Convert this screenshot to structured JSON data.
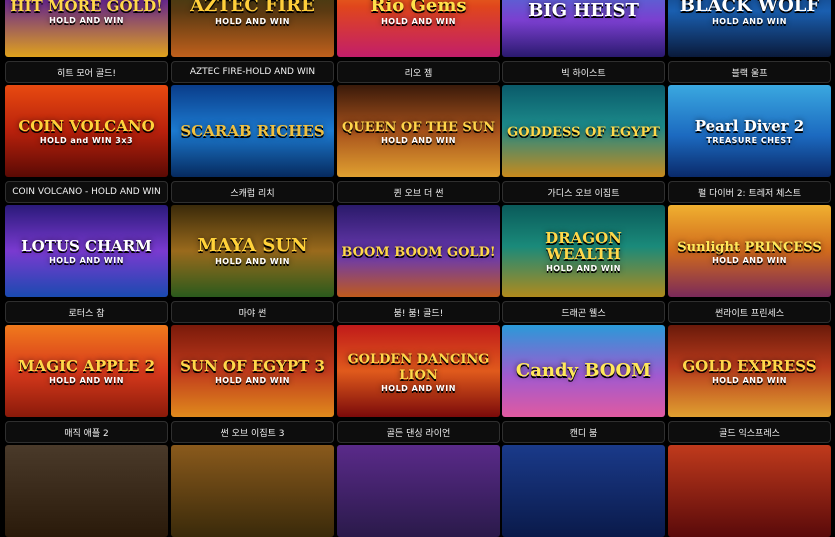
{
  "games": [
    {
      "title": "히트 모어 골드!",
      "art": "HIT MORE GOLD!",
      "sub": "HOLD AND WIN",
      "bg": "linear-gradient(180deg,#1a0a2e 0%,#6b2a8c 40%,#e0a21c 100%)",
      "fg": "#ffd84a"
    },
    {
      "title": "AZTEC FIRE-HOLD AND WIN",
      "art": "AZTEC FIRE",
      "sub": "HOLD AND WIN",
      "bg": "linear-gradient(180deg,#1f3d14 0%,#5b3a12 50%,#c0601c 100%)",
      "fg": "#ffcf3a"
    },
    {
      "title": "리오 젬",
      "art": "Rio Gems",
      "sub": "HOLD AND WIN",
      "bg": "linear-gradient(180deg,#f29a1c 0%,#e0461c 45%,#c21e6a 100%)",
      "fg": "#ffe14a"
    },
    {
      "title": "빅 하이스트",
      "art": "BIG HEIST",
      "sub": "",
      "bg": "linear-gradient(180deg,#2f8fd8 0%,#7b3fd0 60%,#2a1a6e 100%)",
      "fg": "#ffffff"
    },
    {
      "title": "블랙 울프",
      "art": "BLACK WOLF",
      "sub": "HOLD AND WIN",
      "bg": "linear-gradient(180deg,#0b2a5a 0%,#1a5fb0 50%,#0a1a3a 100%)",
      "fg": "#ffffff"
    },
    {
      "title": "COIN VOLCANO - HOLD AND WIN",
      "art": "COIN VOLCANO",
      "sub": "HOLD and WIN 3x3",
      "bg": "linear-gradient(180deg,#e84a10 0%,#b8210c 50%,#5a0a04 100%)",
      "fg": "#ffd23a"
    },
    {
      "title": "스캐럽 리치",
      "art": "SCARAB RICHES",
      "sub": "",
      "bg": "linear-gradient(180deg,#0a3d8a 0%,#1c7ad0 50%,#062a5e 100%)",
      "fg": "#f0c040"
    },
    {
      "title": "퀸 오브 더 썬",
      "art": "QUEEN OF THE SUN",
      "sub": "HOLD AND WIN",
      "bg": "linear-gradient(180deg,#3a1a0a 0%,#a8521c 50%,#e0a030 100%)",
      "fg": "#ffd54a"
    },
    {
      "title": "가디스 오브 이집트",
      "art": "GODDESS OF EGYPT",
      "sub": "",
      "bg": "linear-gradient(180deg,#0a5a6a 0%,#1c8a8a 45%,#c88a1c 100%)",
      "fg": "#ffd84a"
    },
    {
      "title": "펄 다이버 2: 트레저 체스트",
      "art": "Pearl Diver 2",
      "sub": "TREASURE CHEST",
      "bg": "linear-gradient(180deg,#3aa8e0 0%,#1c6ac0 55%,#0a2a6a 100%)",
      "fg": "#ffffff"
    },
    {
      "title": "로터스 참",
      "art": "LOTUS CHARM",
      "sub": "HOLD AND WIN",
      "bg": "linear-gradient(180deg,#2a1a7a 0%,#7a3ad0 50%,#1a4ab0 100%)",
      "fg": "#ffffff"
    },
    {
      "title": "마야 썬",
      "art": "MAYA SUN",
      "sub": "HOLD AND WIN",
      "bg": "linear-gradient(180deg,#3a2a0a 0%,#9a6a1c 50%,#2a5a1c 100%)",
      "fg": "#ffd23a"
    },
    {
      "title": "붐! 붐! 골드!",
      "art": "BOOM BOOM GOLD!",
      "sub": "",
      "bg": "linear-gradient(180deg,#2a1a6a 0%,#6a3ab0 55%,#c05a1c 100%)",
      "fg": "#ffd84a"
    },
    {
      "title": "드래곤 웰스",
      "art": "DRAGON WEALTH",
      "sub": "HOLD AND WIN",
      "bg": "linear-gradient(180deg,#0a5a5a 0%,#1a8a7a 45%,#b08a1c 100%)",
      "fg": "#ffd84a"
    },
    {
      "title": "썬라이트 프린세스",
      "art": "Sunlight PRINCESS",
      "sub": "HOLD AND WIN",
      "bg": "linear-gradient(180deg,#f0b030 0%,#d06a1c 50%,#7a2a5a 100%)",
      "fg": "#ffe85a"
    },
    {
      "title": "매직 애플 2",
      "art": "MAGIC APPLE 2",
      "sub": "HOLD AND WIN",
      "bg": "linear-gradient(180deg,#f07a1c 0%,#d83a1c 50%,#8a1a0a 100%)",
      "fg": "#ffd84a"
    },
    {
      "title": "썬 오브 이집트 3",
      "art": "SUN OF EGYPT 3",
      "sub": "HOLD AND WIN",
      "bg": "linear-gradient(180deg,#7a1a0a 0%,#c03a1c 50%,#e08a1c 100%)",
      "fg": "#ffd84a"
    },
    {
      "title": "골든 댄싱 라이언",
      "art": "GOLDEN DANCING LION",
      "sub": "HOLD AND WIN",
      "bg": "linear-gradient(180deg,#c01a1a 0%,#e05a1c 50%,#7a0a0a 100%)",
      "fg": "#ffd84a"
    },
    {
      "title": "캔디 붐",
      "art": "Candy BOOM",
      "sub": "",
      "bg": "linear-gradient(180deg,#2a9ad8 0%,#a05ad0 55%,#e05aa0 100%)",
      "fg": "#ffe85a"
    },
    {
      "title": "골드 익스프레스",
      "art": "GOLD EXPRESS",
      "sub": "HOLD AND WIN",
      "bg": "linear-gradient(180deg,#6a1a0a 0%,#b83a1c 45%,#e0a030 100%)",
      "fg": "#ffd84a"
    },
    {
      "title": "",
      "art": "",
      "sub": "",
      "bg": "linear-gradient(180deg,#4a3a2a 0%,#2a1a0a 100%)",
      "fg": "#ffffff"
    },
    {
      "title": "",
      "art": "",
      "sub": "",
      "bg": "linear-gradient(180deg,#8a5a1c 0%,#3a2a0a 100%)",
      "fg": "#ffffff"
    },
    {
      "title": "",
      "art": "",
      "sub": "",
      "bg": "linear-gradient(180deg,#5a2a8a 0%,#2a1a4a 100%)",
      "fg": "#ffffff"
    },
    {
      "title": "",
      "art": "",
      "sub": "",
      "bg": "linear-gradient(180deg,#1a3a8a 0%,#0a1a4a 100%)",
      "fg": "#ffffff"
    },
    {
      "title": "",
      "art": "",
      "sub": "",
      "bg": "linear-gradient(180deg,#c03a1c 0%,#5a0a0a 100%)",
      "fg": "#ffffff"
    }
  ]
}
